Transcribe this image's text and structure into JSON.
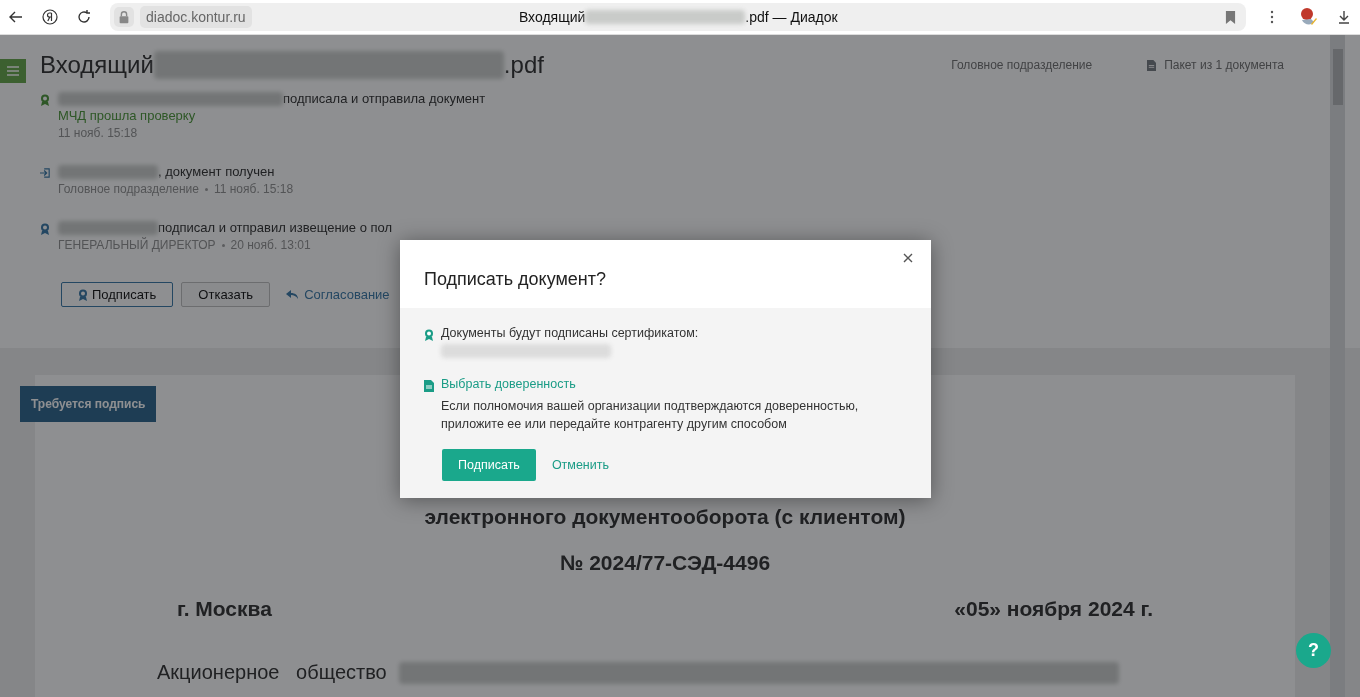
{
  "browser": {
    "address": "diadoc.kontur.ru",
    "title_start": "Входящий",
    "title_end": ".pdf — Диадок"
  },
  "header": {
    "title_start": "Входящий",
    "title_end": ".pdf",
    "department": "Головное подразделение",
    "package": "Пакет из 1 документа"
  },
  "events": [
    {
      "kind": "signed",
      "text": "подписала и отправила документ",
      "status": "МЧД прошла проверку",
      "meta": "11 нояб. 15:18"
    },
    {
      "kind": "received",
      "text": ", документ получен",
      "meta": "Головное подразделение",
      "time": "11 нояб. 15:18"
    },
    {
      "kind": "signed",
      "text": "подписал и отправил извещение о пол",
      "meta": "ГЕНЕРАЛЬНЫЙ ДИРЕКТОР",
      "time": "20 нояб. 13:01"
    }
  ],
  "actions": {
    "sign": "Подписать",
    "reject": "Отказать",
    "approval": "Согласование"
  },
  "document": {
    "badge": "Требуется подпись",
    "subtitle": "электронного документооборота (с клиентом)",
    "number": "№ 2024/77-СЭД-4496",
    "city": "г. Москва",
    "date": "«05» ноября 2024 г.",
    "party": "Акционерное   общество"
  },
  "dialog": {
    "title": "Подписать документ?",
    "cert_label": "Документы будут подписаны сертификатом:",
    "poa_link": "Выбрать доверенность",
    "poa_hint": "Если полномочия вашей организации подтверждаются доверенностью, приложите ее или передайте контрагенту другим способом",
    "confirm": "Подписать",
    "cancel": "Отменить"
  },
  "help": "?"
}
